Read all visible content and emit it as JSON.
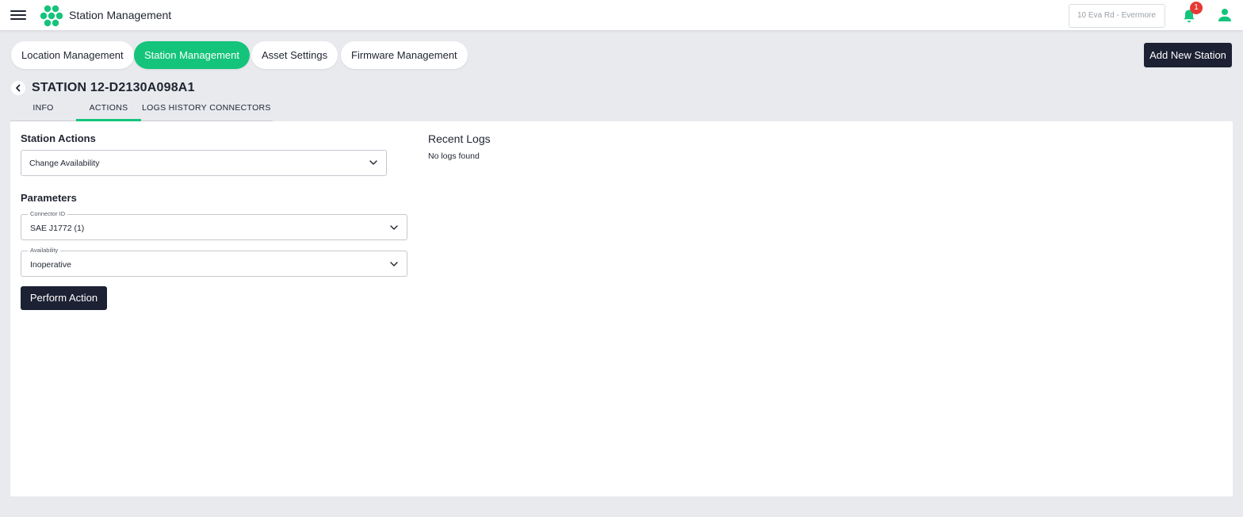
{
  "header": {
    "app_title": "Station Management",
    "location": "10 Eva Rd - Evermore",
    "notification_count": "1",
    "icons": [
      "menu-icon",
      "logo-icon",
      "bell-icon",
      "user-icon"
    ]
  },
  "nav": {
    "items": [
      {
        "label": "Location Management",
        "active": false
      },
      {
        "label": "Station Management",
        "active": true
      },
      {
        "label": "Asset Settings",
        "active": false
      },
      {
        "label": "Firmware Management",
        "active": false
      }
    ],
    "add_button": "Add New Station"
  },
  "station": {
    "title": "STATION 12-D2130A098A1"
  },
  "tabs": {
    "items": [
      {
        "label": "INFO",
        "active": false
      },
      {
        "label": "ACTIONS",
        "active": true
      },
      {
        "label": "LOGS HISTORY",
        "active": false
      },
      {
        "label": "CONNECTORS",
        "active": false
      }
    ]
  },
  "actions": {
    "title": "Station Actions",
    "selected_action": "Change Availability",
    "parameters_title": "Parameters",
    "connector": {
      "label": "Connector ID",
      "value": "SAE J1772 (1)"
    },
    "availability": {
      "label": "Availability",
      "value": "Inoperative"
    },
    "perform_button": "Perform Action"
  },
  "logs": {
    "title": "Recent Logs",
    "empty_text": "No logs found"
  },
  "colors": {
    "accent": "#14c47a",
    "primary_dark": "#1c2133",
    "badge": "#e53935",
    "background": "#e8eaee"
  }
}
